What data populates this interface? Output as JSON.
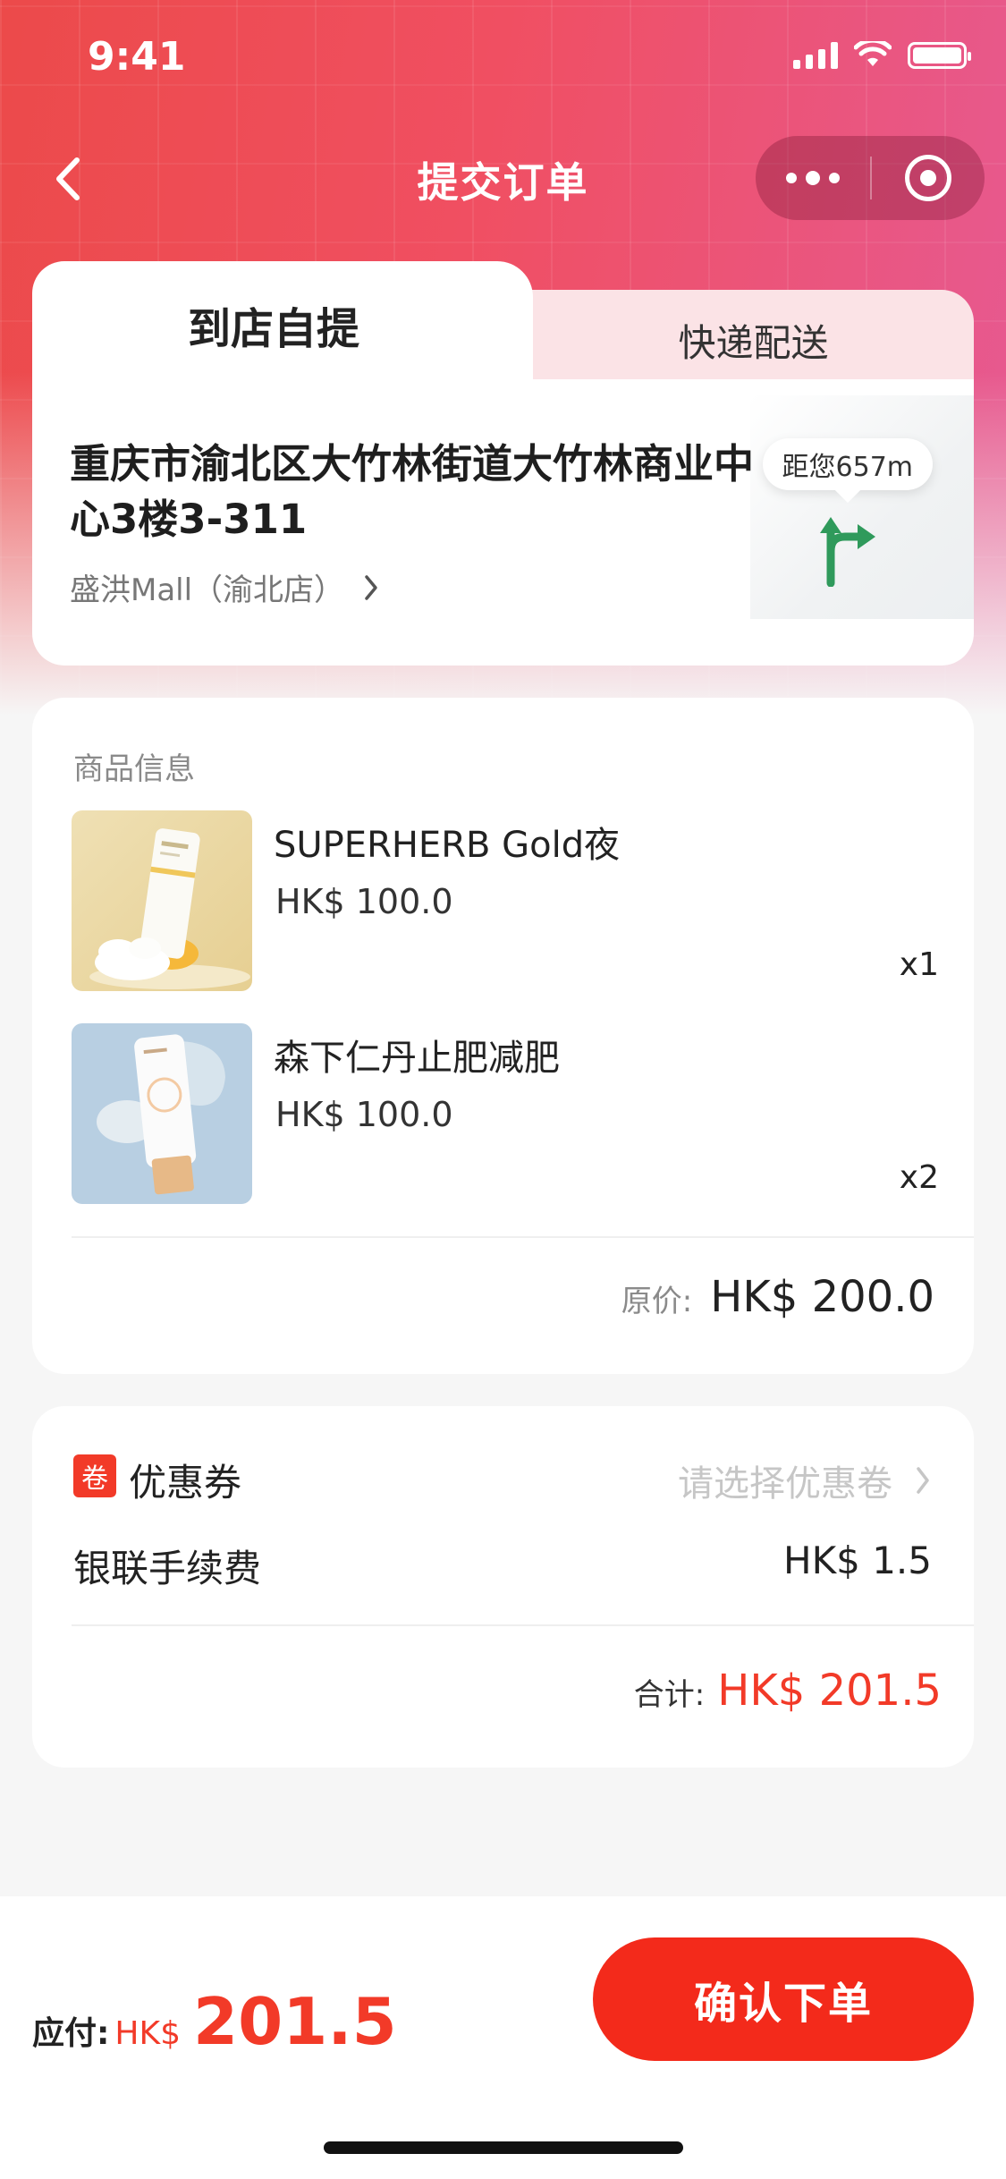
{
  "status_bar": {
    "time": "9:41"
  },
  "nav": {
    "title": "提交订单"
  },
  "delivery": {
    "tabs": [
      {
        "label": "到店自提",
        "active": true
      },
      {
        "label": "快递配送",
        "active": false
      }
    ],
    "address": "重庆市渝北区大竹林街道大竹林商业中心3楼3-311",
    "store_name": "盛洪Mall（渝北店）",
    "distance": "距您657m"
  },
  "products": {
    "section_title": "商品信息",
    "items": [
      {
        "name": "SUPERHERB Gold夜",
        "price": "HK$ 100.0",
        "quantity": "x1"
      },
      {
        "name": "森下仁丹止肥减肥",
        "price": "HK$ 100.0",
        "quantity": "x2"
      }
    ],
    "original_label": "原价:",
    "original_value": "HK$ 200.0"
  },
  "fees": {
    "coupon_badge": "卷",
    "coupon_label": "优惠券",
    "coupon_hint": "请选择优惠卷",
    "fee_label": "银联手续费",
    "fee_value": "HK$ 1.5",
    "total_label": "合计:",
    "total_value": "HK$ 201.5"
  },
  "bottom_bar": {
    "payable_label": "应付:",
    "payable_currency": "HK$",
    "payable_amount": "201.5",
    "confirm_label": "确认下单"
  },
  "colors": {
    "accent_red": "#f32a1b",
    "header_gradient_start": "#ec4a4a",
    "header_gradient_end": "#e65a93",
    "route_green": "#2f9a5b"
  },
  "icons": {
    "back": "chevron-left-icon",
    "more": "more-dots-icon",
    "close": "target-close-icon",
    "store_chevron": "chevron-right-icon",
    "route": "turn-right-arrow-icon",
    "coupon_chevron": "chevron-right-icon"
  }
}
